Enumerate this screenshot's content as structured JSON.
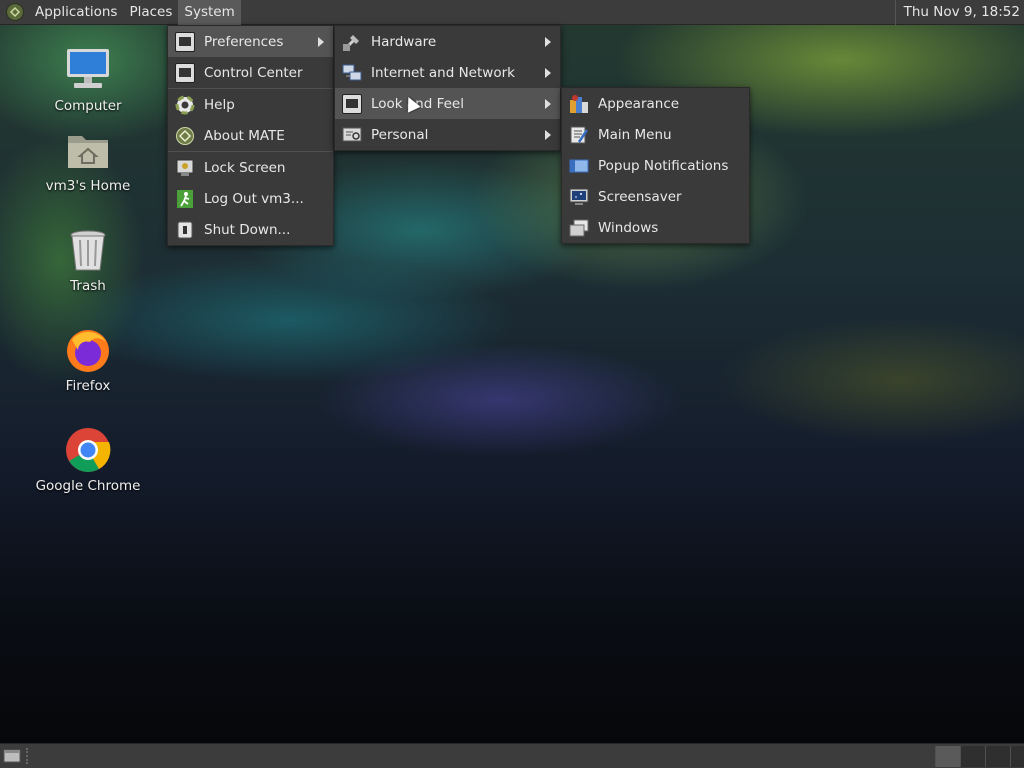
{
  "top_panel": {
    "menus": [
      "Applications",
      "Places",
      "System"
    ],
    "clock": "Thu Nov  9, 18:52"
  },
  "desktop": {
    "icons": [
      {
        "label": "Computer",
        "icon": "computer-icon"
      },
      {
        "label": "vm3's Home",
        "icon": "home-folder-icon"
      },
      {
        "label": "Trash",
        "icon": "trash-icon"
      },
      {
        "label": "Firefox",
        "icon": "firefox-icon"
      },
      {
        "label": "Google Chrome",
        "icon": "chrome-icon"
      }
    ]
  },
  "system_menu": {
    "items": [
      {
        "label": "Preferences",
        "icon": "preferences-icon",
        "submenu": true
      },
      {
        "label": "Control Center",
        "icon": "control-center-icon"
      },
      {
        "label": "Help",
        "icon": "help-icon"
      },
      {
        "label": "About MATE",
        "icon": "about-icon"
      },
      {
        "label": "Lock Screen",
        "icon": "lock-screen-icon"
      },
      {
        "label": "Log Out vm3...",
        "icon": "logout-icon"
      },
      {
        "label": "Shut Down...",
        "icon": "shutdown-icon"
      }
    ]
  },
  "preferences_menu": {
    "items": [
      {
        "label": "Hardware",
        "icon": "hardware-icon",
        "submenu": true
      },
      {
        "label": "Internet and Network",
        "icon": "network-icon",
        "submenu": true
      },
      {
        "label": "Look and Feel",
        "icon": "look-and-feel-icon",
        "submenu": true
      },
      {
        "label": "Personal",
        "icon": "personal-icon",
        "submenu": true
      }
    ]
  },
  "look_and_feel_menu": {
    "items": [
      {
        "label": "Appearance",
        "icon": "appearance-icon"
      },
      {
        "label": "Main Menu",
        "icon": "main-menu-icon"
      },
      {
        "label": "Popup Notifications",
        "icon": "notifications-icon"
      },
      {
        "label": "Screensaver",
        "icon": "screensaver-icon"
      },
      {
        "label": "Windows",
        "icon": "windows-icon"
      }
    ]
  },
  "colors": {
    "panel_bg": "#3c3c3c",
    "menu_bg": "#3a3a3a",
    "menu_highlight": "#545454"
  }
}
